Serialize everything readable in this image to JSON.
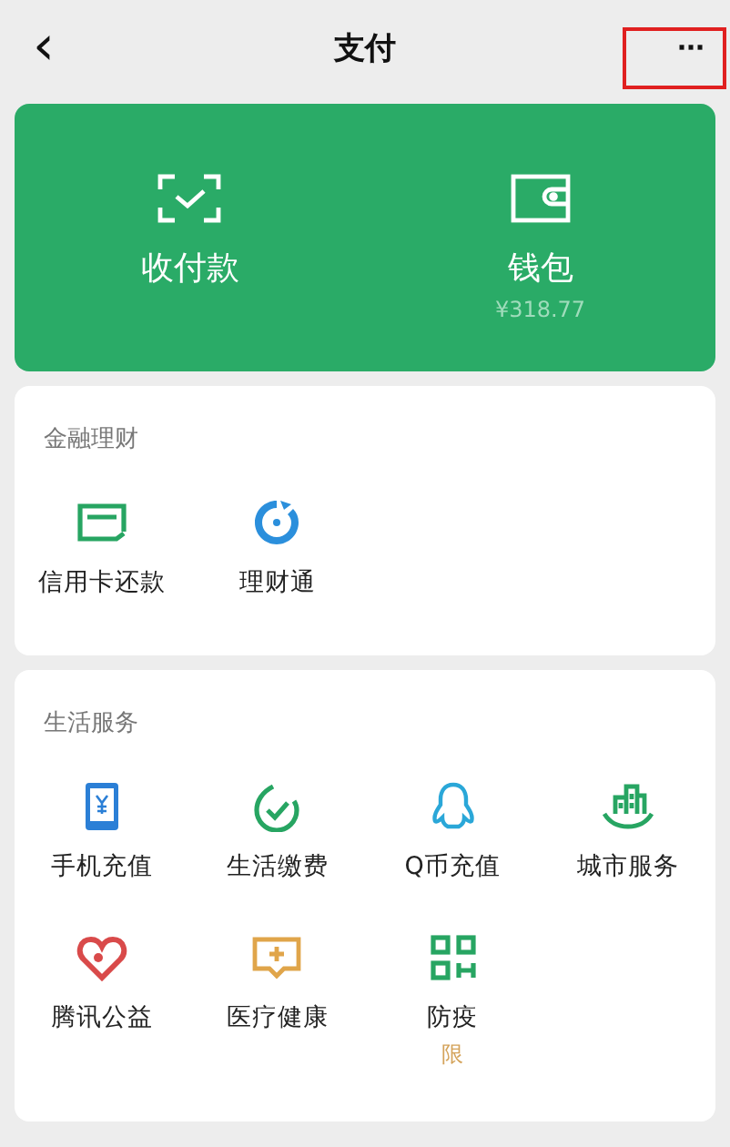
{
  "header": {
    "back": "‹",
    "title": "支付",
    "more": {
      "label": "···",
      "highlighted": true
    }
  },
  "top_card": [
    {
      "label": "收付款"
    },
    {
      "label": "钱包",
      "amount": "¥318.77"
    }
  ],
  "sections": [
    {
      "title": "金融理财",
      "items": [
        {
          "label": "信用卡还款"
        },
        {
          "label": "理财通"
        }
      ]
    },
    {
      "title": "生活服务",
      "items": [
        {
          "label": "手机充值"
        },
        {
          "label": "生活缴费"
        },
        {
          "label": "Q币充值"
        },
        {
          "label": "城市服务"
        },
        {
          "label": "腾讯公益"
        },
        {
          "label": "医疗健康"
        },
        {
          "label": "防疫",
          "note": "限"
        }
      ]
    }
  ]
}
